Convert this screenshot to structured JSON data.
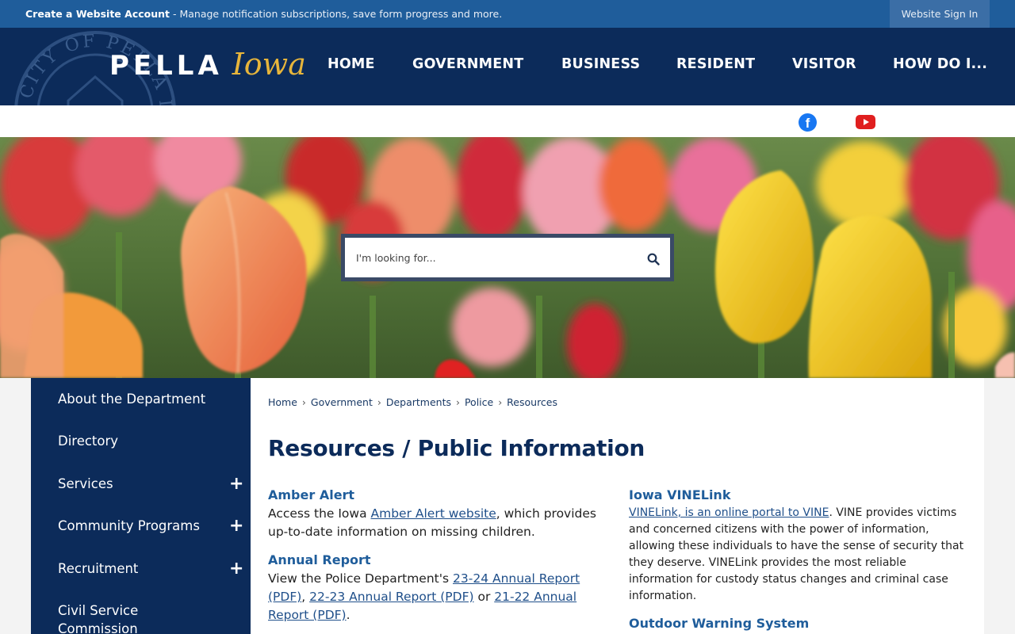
{
  "topbar": {
    "create_account_link": "Create a Website Account",
    "message": " - Manage notification subscriptions, save form progress and more.",
    "sign_in": "Website Sign In"
  },
  "header": {
    "logo_main": "PELLA",
    "logo_script": "Iowa",
    "seal_text": "CITY OF PELLA IOWA",
    "nav": [
      "HOME",
      "GOVERNMENT",
      "BUSINESS",
      "RESIDENT",
      "VISITOR",
      "HOW DO I..."
    ]
  },
  "social": {
    "facebook_icon": "facebook-icon",
    "youtube_icon": "youtube-icon",
    "facebook_glyph": "f"
  },
  "search": {
    "placeholder": "I'm looking for..."
  },
  "sidebar": {
    "items": [
      {
        "label": "About the Department",
        "expandable": false
      },
      {
        "label": "Directory",
        "expandable": false
      },
      {
        "label": "Services",
        "expandable": true
      },
      {
        "label": "Community Programs",
        "expandable": true
      },
      {
        "label": "Recruitment",
        "expandable": true
      },
      {
        "label": "Civil Service",
        "label2": "Commission",
        "expandable": false
      }
    ],
    "expand_glyph": "+"
  },
  "breadcrumb": {
    "items": [
      "Home",
      "Government",
      "Departments",
      "Police",
      "Resources"
    ],
    "separator": "›"
  },
  "page": {
    "title": "Resources / Public Information"
  },
  "sections": {
    "amber": {
      "title": "Amber Alert",
      "text1": "Access the Iowa ",
      "link": "Amber Alert website",
      "text2": ", which provides up-to-date information on missing children."
    },
    "annual": {
      "title": "Annual Report",
      "text1": "View the Police Department's ",
      "link1": "23-24 Annual Report (PDF)",
      "text2": ", ",
      "link2": "22-23 Annual Report (PDF)",
      "text3": " or ",
      "link3": "21-22 Annual Report (PDF)",
      "text4": "."
    },
    "vinelink": {
      "title": "Iowa VINELink",
      "link": "VINELink, is an online portal to VINE",
      "text": ". VINE provides victims and concerned citizens with the power of information, allowing these individuals to have the sense of security that they deserve. VINELink provides the most reliable information for custody status changes and criminal case information."
    },
    "outdoor": {
      "title": "Outdoor Warning System"
    }
  }
}
